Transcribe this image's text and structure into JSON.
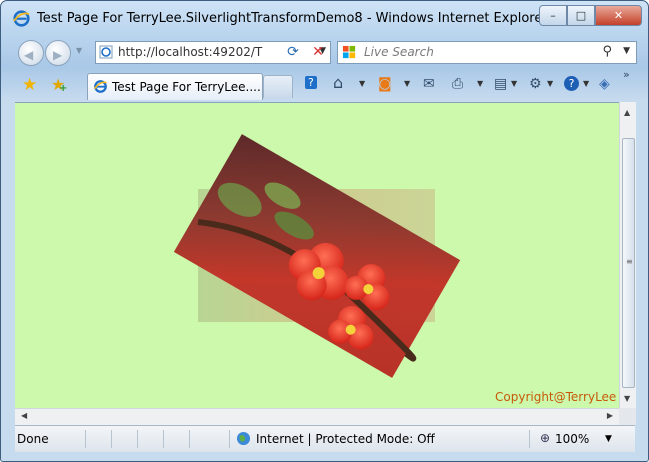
{
  "window": {
    "title": "Test Page For TerryLee.SilverlightTransformDemo8 - Windows Internet Explorer",
    "controls": {
      "minimize": "–",
      "maximize": "□",
      "close": "✕"
    }
  },
  "navigation": {
    "back": "◀",
    "forward": "▶",
    "address": "http://localhost:49202/T",
    "dropdown": "▼",
    "refresh": "⟳",
    "stop": "✕"
  },
  "search": {
    "placeholder": "Live Search",
    "icon": "⚲",
    "dropdown": "▼"
  },
  "tabs": [
    {
      "label": "Test Page For TerryLee...."
    }
  ],
  "toolbar": {
    "favorites": "★",
    "add_favorites": "★",
    "add_plus": "+",
    "quick_tabs": "?",
    "home": "⌂",
    "feeds": "◙",
    "mail": "✉",
    "print": "⎙",
    "page": "▤",
    "tools": "⚙",
    "help": "?",
    "research": "◈",
    "chevron": "»",
    "dd": "▼"
  },
  "content": {
    "copyright": "Copyright@TerryLee"
  },
  "scroll": {
    "up": "▲",
    "down": "▼",
    "left": "◀",
    "right": "▶",
    "grip": "≡"
  },
  "status": {
    "text": "Done",
    "zone": "Internet | Protected Mode: Off",
    "zoom": "100%",
    "zoom_icon": "⊕",
    "zoom_dd": "▼"
  },
  "colors": {
    "page_background": "#ccf9ab",
    "copyright": "#c75a0a"
  }
}
